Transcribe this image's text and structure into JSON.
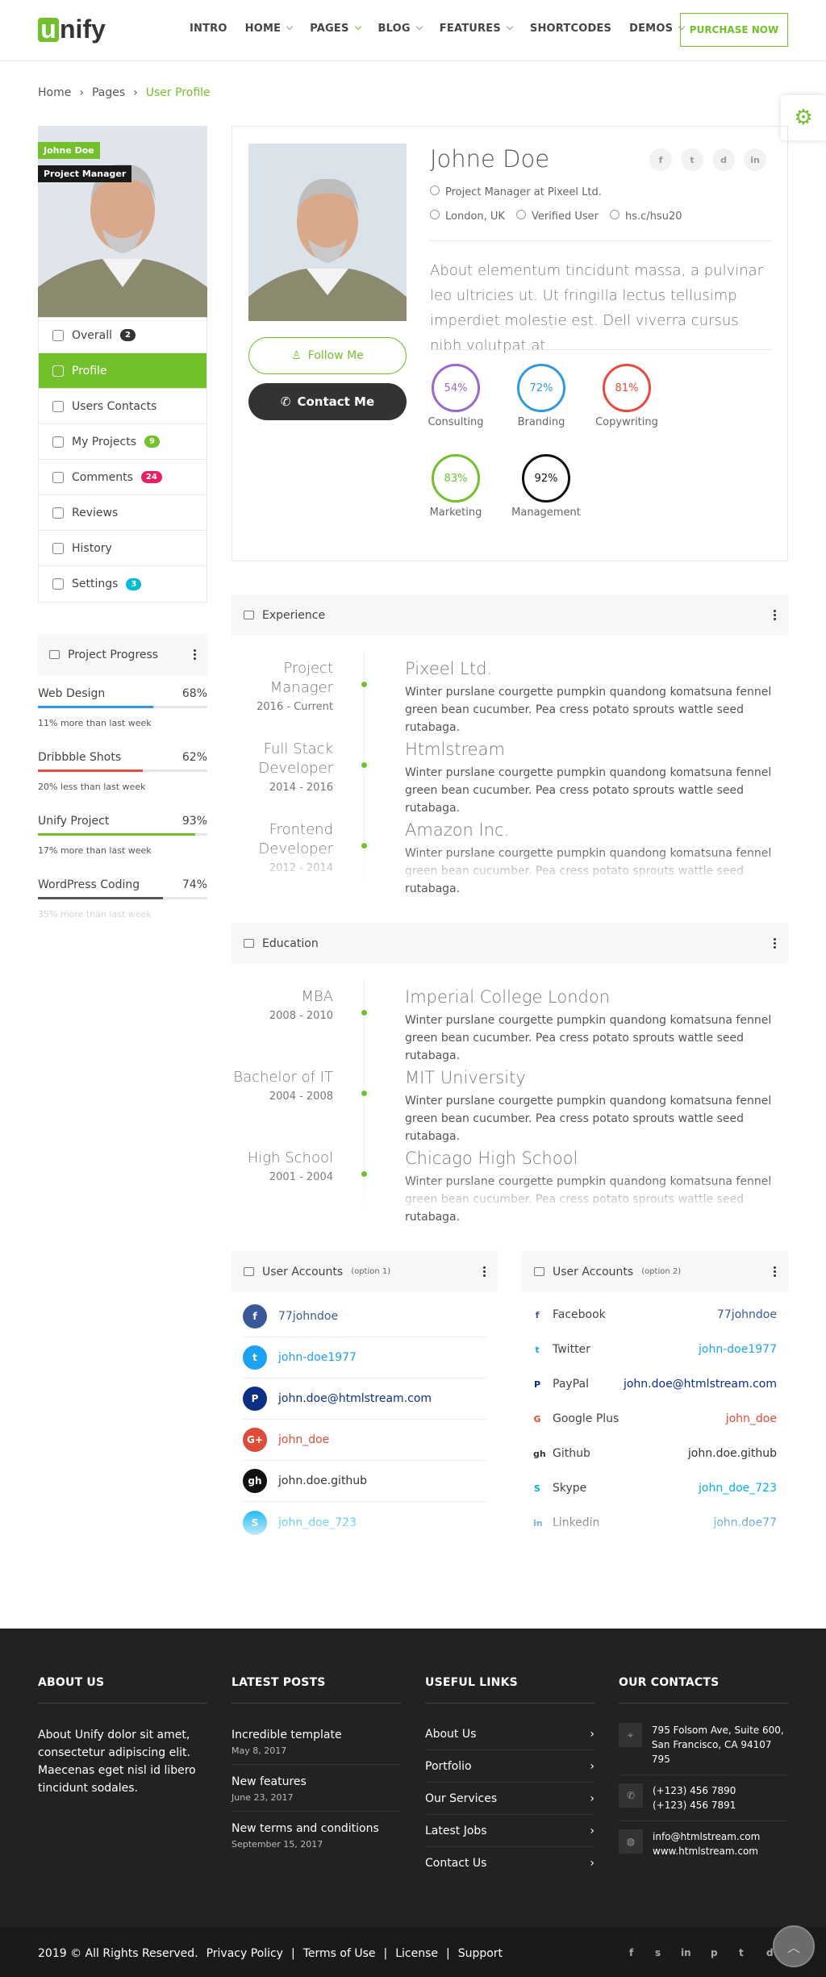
{
  "header": {
    "logo_rest": "nify",
    "logo_letter": "u",
    "nav": [
      "INTRO",
      "HOME",
      "PAGES",
      "BLOG",
      "FEATURES",
      "SHORTCODES",
      "DEMOS"
    ],
    "purchase": "PURCHASE NOW"
  },
  "breadcrumb": [
    "Home",
    "Pages",
    "User Profile"
  ],
  "side": {
    "name_tag": "Johne Doe",
    "role_tag": "Project Manager",
    "menu": [
      {
        "label": "Overall",
        "badge": "2"
      },
      {
        "label": "Profile"
      },
      {
        "label": "Users Contacts"
      },
      {
        "label": "My Projects",
        "badge": "9"
      },
      {
        "label": "Comments",
        "badge": "24"
      },
      {
        "label": "Reviews"
      },
      {
        "label": "History"
      },
      {
        "label": "Settings",
        "badge": "3"
      }
    ]
  },
  "progress": {
    "title": "Project Progress",
    "items": [
      {
        "name": "Web Design",
        "pct": "68%",
        "value": 0.68,
        "note": "11% more than last week",
        "color": "#3398dc"
      },
      {
        "name": "Dribbble Shots",
        "pct": "62%",
        "value": 0.62,
        "note": "20% less than last week",
        "color": "#e74b3c"
      },
      {
        "name": "Unify Project",
        "pct": "93%",
        "value": 0.93,
        "note": "17% more than last week",
        "color": "#72c02c"
      },
      {
        "name": "WordPress Coding",
        "pct": "74%",
        "value": 0.74,
        "note": "35% more than last week",
        "color": "#555555"
      }
    ]
  },
  "profile": {
    "name": "Johne Doe",
    "job": "Project Manager at Pixeel Ltd.",
    "location": "London, UK",
    "verified": "Verified User",
    "link": "hs.c/hsu20",
    "bio": "About elementum tincidunt massa, a pulvinar leo ultricies ut. Ut fringilla lectus tellusimp imperdiet molestie est. Dell viverra cursus nibh volutpat at.",
    "follow": "Follow Me",
    "contact": "Contact Me",
    "social": [
      "f",
      "t",
      "d",
      "in"
    ],
    "skills": [
      {
        "pct": "54%",
        "label": "Consulting",
        "color": "#9a69cb"
      },
      {
        "pct": "72%",
        "label": "Branding",
        "color": "#3398dc"
      },
      {
        "pct": "81%",
        "label": "Copywriting",
        "color": "#e74b3c"
      },
      {
        "pct": "83%",
        "label": "Marketing",
        "color": "#72c02c"
      },
      {
        "pct": "92%",
        "label": "Management",
        "color": "#111111"
      }
    ]
  },
  "experience": {
    "title": "Experience",
    "items": [
      {
        "role": "Project Manager",
        "date": "2016 - Current",
        "company": "Pixeel Ltd.",
        "desc": "Winter purslane courgette pumpkin quandong komatsuna fennel green bean cucumber. Pea cress potato sprouts wattle seed rutabaga."
      },
      {
        "role": "Full Stack Developer",
        "date": "2014 - 2016",
        "company": "Htmlstream",
        "desc": "Winter purslane courgette pumpkin quandong komatsuna fennel green bean cucumber. Pea cress potato sprouts wattle seed rutabaga."
      },
      {
        "role": "Frontend Developer",
        "date": "2012 - 2014",
        "company": "Amazon Inc.",
        "desc": "Winter purslane courgette pumpkin quandong komatsuna fennel green bean cucumber. Pea cress potato sprouts wattle seed rutabaga."
      }
    ]
  },
  "education": {
    "title": "Education",
    "items": [
      {
        "role": "MBA",
        "date": "2008 - 2010",
        "company": "Imperial College London",
        "desc": "Winter purslane courgette pumpkin quandong komatsuna fennel green bean cucumber. Pea cress potato sprouts wattle seed rutabaga."
      },
      {
        "role": "Bachelor of IT",
        "date": "2004 - 2008",
        "company": "MIT University",
        "desc": "Winter purslane courgette pumpkin quandong komatsuna fennel green bean cucumber. Pea cress potato sprouts wattle seed rutabaga."
      },
      {
        "role": "High School",
        "date": "2001 - 2004",
        "company": "Chicago High School",
        "desc": "Winter purslane courgette pumpkin quandong komatsuna fennel green bean cucumber. Pea cress potato sprouts wattle seed rutabaga."
      }
    ]
  },
  "accounts1": {
    "title": "User Accounts",
    "option": "(option 1)",
    "items": [
      {
        "icon": "f",
        "value": "77johndoe",
        "bg": "#3b5998",
        "color": "#3b5998"
      },
      {
        "icon": "t",
        "value": "john-doe1977",
        "bg": "#1da1f2",
        "color": "#1da1f2"
      },
      {
        "icon": "P",
        "value": "john.doe@htmlstream.com",
        "bg": "#0c2f86",
        "color": "#0c2f86"
      },
      {
        "icon": "G+",
        "value": "john_doe",
        "bg": "#dd4b39",
        "color": "#dd4b39"
      },
      {
        "icon": "gh",
        "value": "john.doe.github",
        "bg": "#111111",
        "color": "#333333"
      },
      {
        "icon": "S",
        "value": "john_doe_723",
        "bg": "#00aff0",
        "color": "#00aff0"
      }
    ]
  },
  "accounts2": {
    "title": "User Accounts",
    "option": "(option 2)",
    "items": [
      {
        "icon": "f",
        "name": "Facebook",
        "value": "77johndoe",
        "color": "#3b5998"
      },
      {
        "icon": "t",
        "name": "Twitter",
        "value": "john-doe1977",
        "color": "#1da1f2"
      },
      {
        "icon": "P",
        "name": "PayPal",
        "value": "john.doe@htmlstream.com",
        "color": "#0c2f86"
      },
      {
        "icon": "G",
        "name": "Google Plus",
        "value": "john_doe",
        "color": "#dd4b39"
      },
      {
        "icon": "gh",
        "name": "Github",
        "value": "john.doe.github",
        "color": "#333333"
      },
      {
        "icon": "S",
        "name": "Skype",
        "value": "john_doe_723",
        "color": "#00aff0"
      },
      {
        "icon": "in",
        "name": "Linkedin",
        "value": "john.doe77",
        "color": "#0077b5"
      }
    ]
  },
  "footer": {
    "about_title": "ABOUT US",
    "about": "About Unify dolor sit amet, consectetur adipiscing elit. Maecenas eget nisl id libero tincidunt sodales.",
    "posts_title": "LATEST POSTS",
    "posts": [
      {
        "t": "Incredible template",
        "d": "May 8, 2017"
      },
      {
        "t": "New features",
        "d": "June 23, 2017"
      },
      {
        "t": "New terms and conditions",
        "d": "September 15, 2017"
      }
    ],
    "links_title": "USEFUL LINKS",
    "links": [
      "About Us",
      "Portfolio",
      "Our Services",
      "Latest Jobs",
      "Contact Us"
    ],
    "contacts_title": "OUR CONTACTS",
    "address1": "795 Folsom Ave, Suite 600,",
    "address2": "San Francisco, CA 94107 795",
    "phone1": "(+123) 456 7890",
    "phone2": "(+123) 456 7891",
    "email": "info@htmlstream.com",
    "web": "www.htmlstream.com",
    "copyright": "2019 © All Rights Reserved.",
    "bottom_links": [
      "Privacy Policy",
      "Terms of Use",
      "License",
      "Support"
    ],
    "social": [
      "f",
      "s",
      "in",
      "p",
      "t",
      "d"
    ]
  }
}
